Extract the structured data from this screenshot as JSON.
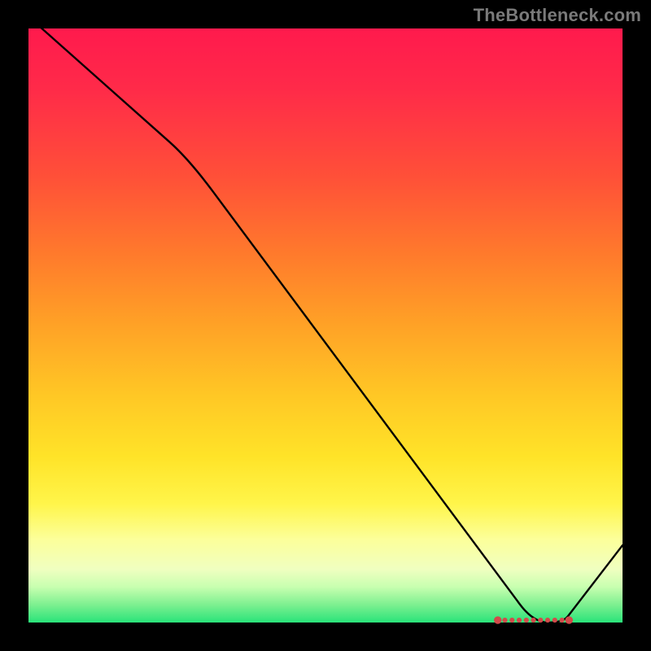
{
  "attribution": "TheBottleneck.com",
  "chart_data": {
    "type": "line",
    "title": "",
    "xlabel": "",
    "ylabel": "",
    "xlim": [
      0,
      100
    ],
    "ylim": [
      0,
      100
    ],
    "x": [
      0,
      27,
      85,
      90,
      100
    ],
    "values": [
      102,
      78,
      0,
      0,
      13
    ],
    "optimal_band": {
      "x_start": 79,
      "x_end": 91,
      "y": 0.4
    },
    "optimal_markers_x": [
      79,
      80.2,
      81.4,
      82.6,
      83.8,
      85,
      86.2,
      87.4,
      88.6,
      89.8,
      91
    ]
  },
  "colors": {
    "curve": "#000000",
    "marker": "#d24a4a",
    "gradient_top": "#ff1a4d",
    "gradient_bottom": "#29e37a",
    "frame": "#000000",
    "attribution": "#7a7a7a"
  }
}
